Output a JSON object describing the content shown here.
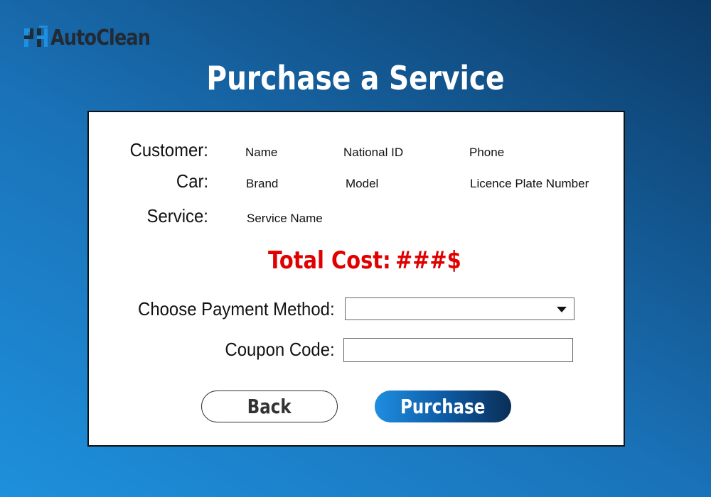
{
  "brand": {
    "name": "AutoClean",
    "icon": "autoclean-logo-icon"
  },
  "page": {
    "title": "Purchase a Service"
  },
  "customer": {
    "label": "Customer:",
    "name": "Name",
    "national_id": "National ID",
    "phone": "Phone"
  },
  "car": {
    "label": "Car:",
    "brand": "Brand",
    "model": "Model",
    "plate": "Licence Plate Number"
  },
  "service": {
    "label": "Service:",
    "name": "Service Name"
  },
  "total": {
    "label": "Total Cost:",
    "value": "###$"
  },
  "payment": {
    "label": "Choose Payment Method:",
    "selected": "",
    "icon": "chevron-down-icon"
  },
  "coupon": {
    "label": "Coupon Code:",
    "value": ""
  },
  "buttons": {
    "back": "Back",
    "purchase": "Purchase"
  },
  "colors": {
    "background_start": "#1e90dc",
    "background_end": "#0c3a66",
    "total_cost": "#e00000",
    "purchase_button_start": "#1f8ee0",
    "purchase_button_end": "#0a2e57"
  }
}
